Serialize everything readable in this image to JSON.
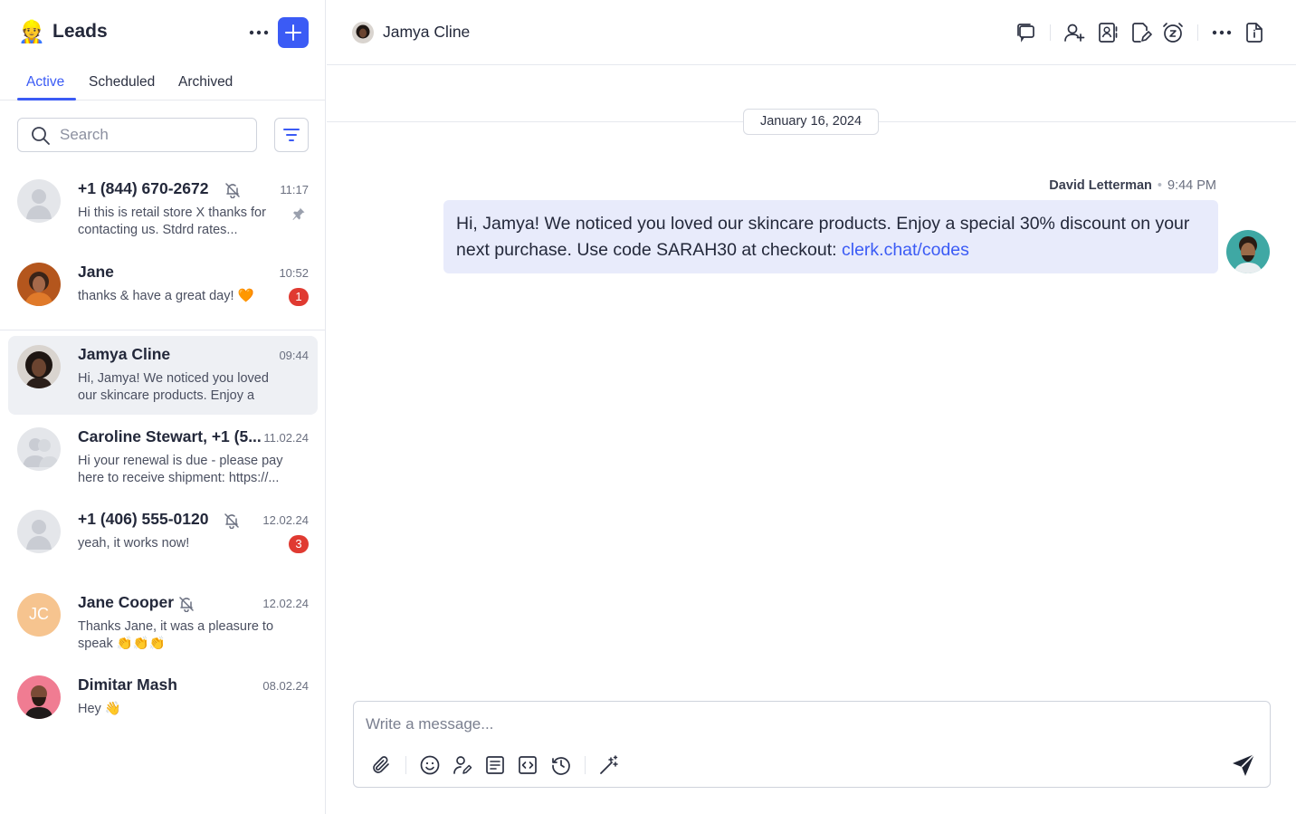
{
  "sidebar": {
    "emoji": "👷",
    "title": "Leads",
    "tabs": [
      {
        "label": "Active"
      },
      {
        "label": "Scheduled"
      },
      {
        "label": "Archived"
      }
    ],
    "search": {
      "placeholder": "Search",
      "value": ""
    },
    "conversations": [
      {
        "name": "+1 (844) 670-2672",
        "time": "11:17",
        "preview": "Hi this is retail store X thanks for contacting us. Stdrd rates...",
        "muted": true,
        "pinned": true
      },
      {
        "name": "Jane",
        "time": "10:52",
        "preview": "thanks & have a great day! 🧡",
        "badge": "1"
      },
      {
        "name": "Jamya Cline",
        "time": "09:44",
        "preview": "Hi, Jamya! We noticed you loved our skincare products. Enjoy a spe...",
        "selected": true
      },
      {
        "name": "Caroline Stewart, +1 (5...",
        "time": "11.02.24",
        "preview": "Hi your renewal is due - please pay here to receive shipment: https://..."
      },
      {
        "name": "+1 (406) 555-0120",
        "time": "12.02.24",
        "preview": "yeah, it works now!",
        "muted": true,
        "badge": "3"
      },
      {
        "name": "Jane Cooper",
        "initials": "JC",
        "time": "12.02.24",
        "preview": "Thanks Jane, it was a pleasure to speak 👏👏👏",
        "muted": true
      },
      {
        "name": "Dimitar Mash",
        "time": "08.02.24",
        "preview": "Hey 👋"
      }
    ]
  },
  "chat": {
    "contact_name": "Jamya Cline",
    "date_divider": "January 16, 2024",
    "message": {
      "sender": "David Letterman",
      "time": "9:44 PM",
      "text": "Hi, Jamya! We noticed you loved our skincare products. Enjoy a special 30% discount on your next purchase. Use code SARAH30 at checkout: ",
      "link_text": "clerk.chat/codes"
    },
    "composer": {
      "placeholder": "Write a message...",
      "value": ""
    }
  },
  "colors": {
    "accent": "#3b5bf5",
    "badge": "#e03a31",
    "bubble": "#e8ebfb",
    "selected_row": "#eef0f4"
  },
  "icons": {
    "topbar": [
      "conversations-icon",
      "add-contact-icon",
      "contact-card-icon",
      "edit-note-icon",
      "snooze-alarm-icon",
      "more-icon",
      "document-icon"
    ],
    "composer": [
      "attachment-icon",
      "emoji-icon",
      "assign-user-icon",
      "template-icon",
      "code-snippet-icon",
      "schedule-icon",
      "ai-magic-wand-icon",
      "send-icon"
    ]
  }
}
